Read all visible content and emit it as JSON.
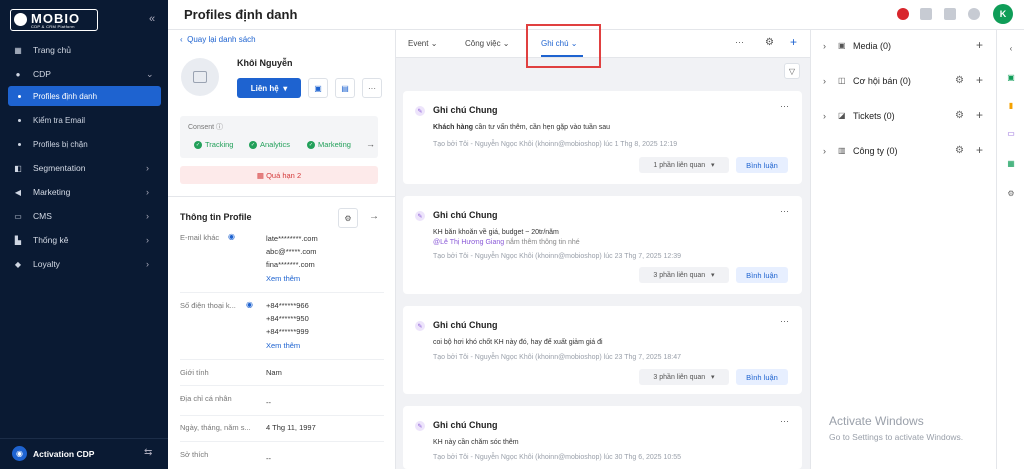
{
  "brand": {
    "name": "MOBIO",
    "tagline": "CDP & CRM Platform"
  },
  "sidebar": {
    "items": [
      {
        "label": "Trang chủ",
        "icon": "home-grid-icon"
      },
      {
        "label": "CDP",
        "icon": "user-icon"
      },
      {
        "label": "Segmentation",
        "icon": "segment-icon"
      },
      {
        "label": "Marketing",
        "icon": "megaphone-icon"
      },
      {
        "label": "CMS",
        "icon": "monitor-icon"
      },
      {
        "label": "Thống kê",
        "icon": "chart-icon"
      },
      {
        "label": "Loyalty",
        "icon": "diamond-icon"
      }
    ],
    "cdp_sub": [
      "Profiles định danh",
      "Kiểm tra Email",
      "Profiles bị chặn"
    ],
    "bottom": "Activation CDP"
  },
  "header": {
    "title": "Profiles định danh",
    "avatar": "K"
  },
  "profile": {
    "back": "Quay lại danh sách",
    "name": "Khôi Nguyễn",
    "contact_btn": "Liên hệ",
    "consent_label": "Consent",
    "consents": [
      "Tracking",
      "Analytics",
      "Marketing"
    ],
    "overdue_label": "Quá hạn",
    "overdue_count": "2",
    "section_title": "Thông tin Profile",
    "fields": {
      "email_label": "E-mail khác",
      "emails": [
        "late********.com",
        "abc@*****.com",
        "fina*******.com"
      ],
      "email_more": "Xem thêm",
      "phone_label": "Số điện thoại k...",
      "phones": [
        "+84******966",
        "+84******950",
        "+84******999"
      ],
      "phone_more": "Xem thêm",
      "gender_label": "Giới tính",
      "gender": "Nam",
      "address_label": "Địa chỉ cá nhân",
      "address": "--",
      "dob_label": "Ngày, tháng, năm s...",
      "dob": "4 Thg 11, 1997",
      "hobby_label": "Sở thích",
      "hobby": "--"
    }
  },
  "tabs": [
    "Event",
    "Công việc",
    "Ghi chú"
  ],
  "notes": [
    {
      "title": "Ghi chú Chung",
      "body_bold": "Khách hàng",
      "body": " cần tư vấn thêm, cần hẹn gặp vào tuần sau",
      "mention": "",
      "meta": "Tạo bởi Tôi - Nguyễn Ngọc Khôi (khoinn@mobioshop) lúc 1 Thg 8, 2025 12:19",
      "related": "1 phần liên quan",
      "reply": "Bình luận"
    },
    {
      "title": "Ghi chú Chung",
      "body_bold": "",
      "body": "KH băn khoăn về giá, budget ~ 20tr/năm",
      "mention": "@Lê Thị Hương Giang",
      "mention_rest": " nắm thêm thông tin nhé",
      "meta": "Tạo bởi Tôi - Nguyễn Ngọc Khôi (khoinn@mobioshop) lúc 23 Thg 7, 2025 12:39",
      "related": "3 phần liên quan",
      "reply": "Bình luận"
    },
    {
      "title": "Ghi chú Chung",
      "body_bold": "",
      "body": "coi bộ hơi khó chốt KH này đó, hay để xuất giảm giá đi",
      "mention": "",
      "meta": "Tạo bởi Tôi - Nguyễn Ngọc Khôi (khoinn@mobioshop) lúc 23 Thg 7, 2025 18:47",
      "related": "3 phần liên quan",
      "reply": "Bình luận"
    },
    {
      "title": "Ghi chú Chung",
      "body_bold": "",
      "body": "KH này cần chăm sóc thêm",
      "mention": "",
      "meta": "Tạo bởi Tôi - Nguyễn Ngọc Khôi (khoinn@mobioshop) lúc 30 Thg 6, 2025 10:55",
      "related": "",
      "reply": ""
    }
  ],
  "right_panel": [
    {
      "label": "Media (0)",
      "icon": "media-icon"
    },
    {
      "label": "Cơ hội bán (0)",
      "icon": "deal-icon"
    },
    {
      "label": "Tickets (0)",
      "icon": "ticket-icon"
    },
    {
      "label": "Công ty (0)",
      "icon": "company-icon"
    }
  ],
  "watermark": {
    "title": "Activate Windows",
    "sub": "Go to Settings to activate Windows."
  },
  "colors": {
    "sidebar": "#0a1a33",
    "accent": "#1e63d0",
    "consent_green": "#22a05a",
    "highlight_red": "#e04040"
  }
}
